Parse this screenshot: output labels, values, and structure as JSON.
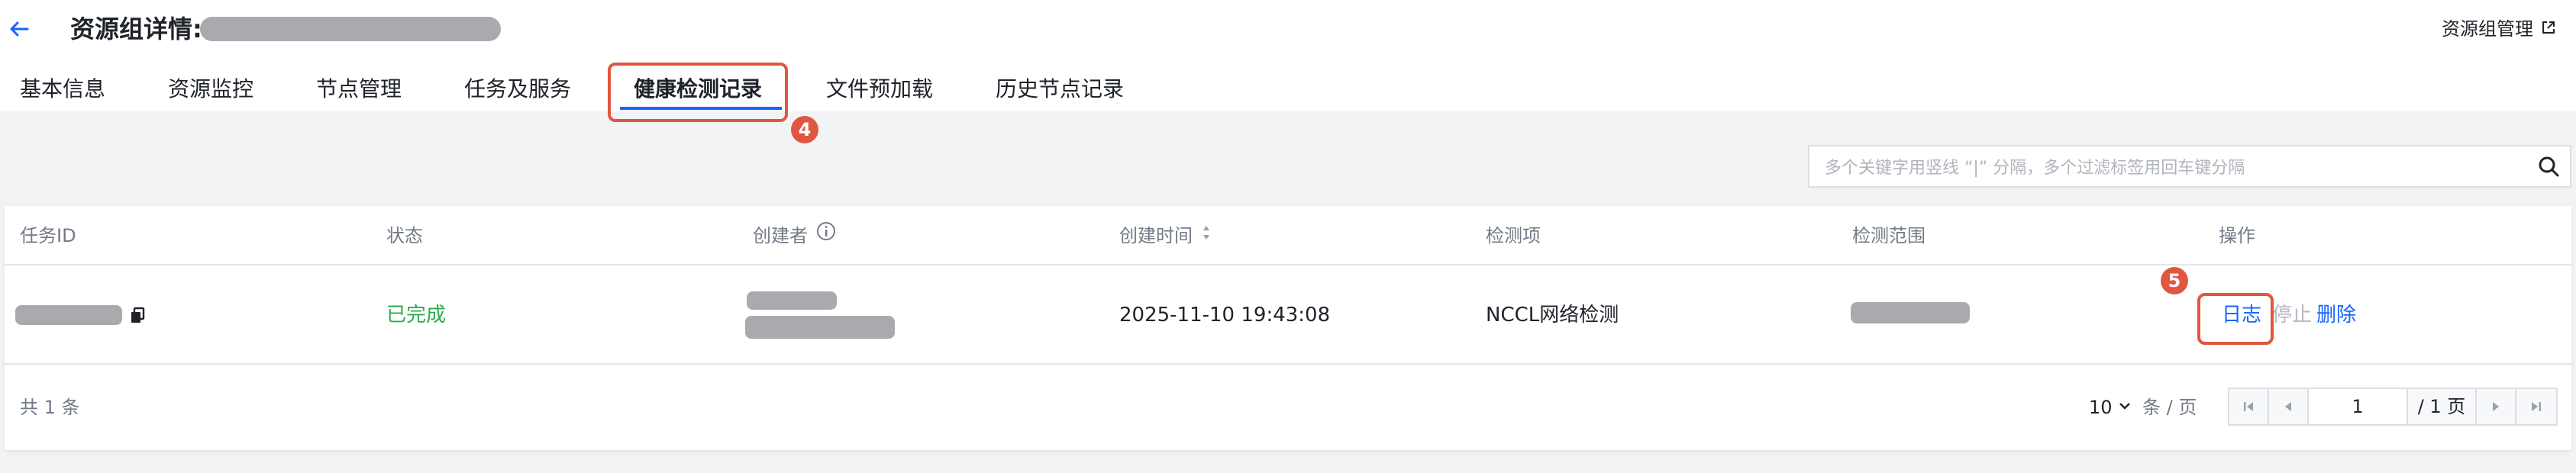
{
  "header": {
    "title": "资源组详情:",
    "manage_link": "资源组管理"
  },
  "tabs": [
    {
      "label": "基本信息"
    },
    {
      "label": "资源监控"
    },
    {
      "label": "节点管理"
    },
    {
      "label": "任务及服务"
    },
    {
      "label": "健康检测记录"
    },
    {
      "label": "文件预加载"
    },
    {
      "label": "历史节点记录"
    }
  ],
  "steps": {
    "tab_step": "4",
    "log_step": "5"
  },
  "search": {
    "placeholder": "多个关键字用竖线 “|” 分隔，多个过滤标签用回车键分隔"
  },
  "table": {
    "columns": [
      "任务ID",
      "状态",
      "创建者",
      "创建时间",
      "检测项",
      "检测范围",
      "操作"
    ],
    "rows": [
      {
        "status": "已完成",
        "created_time": "2025-11-10 19:43:08",
        "check_item": "NCCL网络检测",
        "actions": {
          "log": "日志",
          "stop": "停止",
          "delete": "删除"
        }
      }
    ]
  },
  "footer": {
    "total": "共 1 条",
    "page_size": "10",
    "page_size_unit": "条 / 页",
    "current_page": "1",
    "total_pages": "/ 1 页"
  },
  "colors": {
    "accent": "#1664ff",
    "success": "#2fa851",
    "highlight": "#e0563f"
  }
}
